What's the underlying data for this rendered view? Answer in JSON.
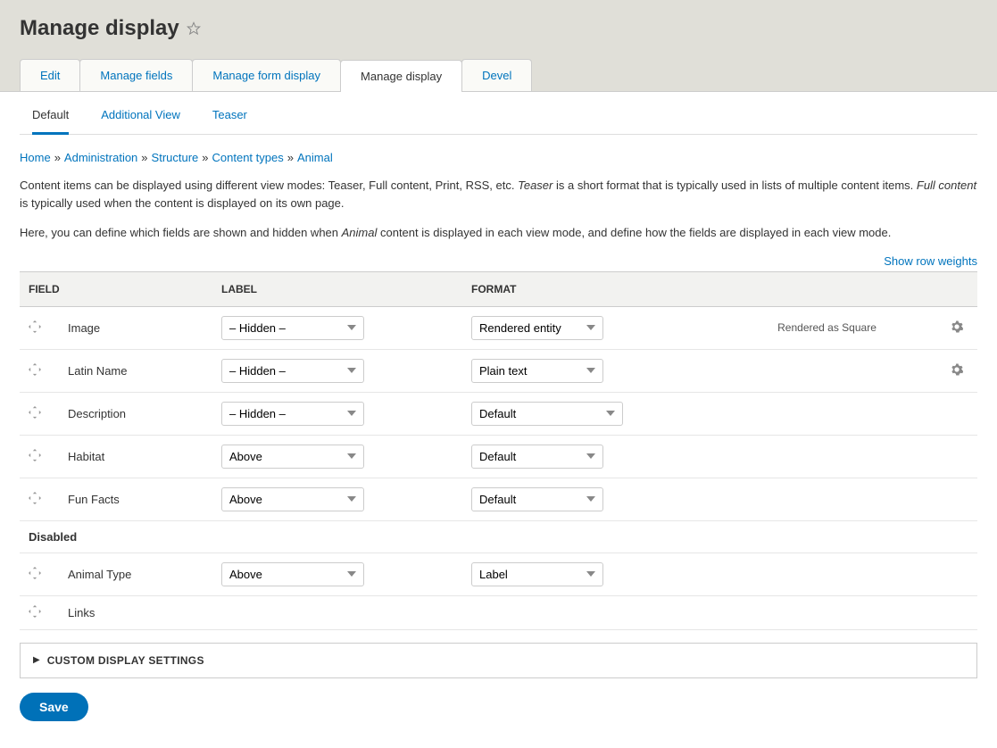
{
  "page_title": "Manage display",
  "primary_tabs": [
    {
      "label": "Edit",
      "active": false
    },
    {
      "label": "Manage fields",
      "active": false
    },
    {
      "label": "Manage form display",
      "active": false
    },
    {
      "label": "Manage display",
      "active": true
    },
    {
      "label": "Devel",
      "active": false
    }
  ],
  "secondary_tabs": [
    {
      "label": "Default",
      "active": true
    },
    {
      "label": "Additional View",
      "active": false
    },
    {
      "label": "Teaser",
      "active": false
    }
  ],
  "breadcrumb": [
    {
      "label": "Home"
    },
    {
      "label": "Administration"
    },
    {
      "label": "Structure"
    },
    {
      "label": "Content types"
    },
    {
      "label": "Animal"
    }
  ],
  "help_line1_a": "Content items can be displayed using different view modes: Teaser, Full content, Print, RSS, etc. ",
  "help_line1_em1": "Teaser",
  "help_line1_b": " is a short format that is typically used in lists of multiple content items. ",
  "help_line1_em2": "Full content",
  "help_line1_c": " is typically used when the content is displayed on its own page.",
  "help_line2_a": "Here, you can define which fields are shown and hidden when ",
  "help_line2_em": "Animal",
  "help_line2_b": " content is displayed in each view mode, and define how the fields are displayed in each view mode.",
  "toggle_weights": "Show row weights",
  "table": {
    "headers": {
      "field": "Field",
      "label": "Label",
      "format": "Format"
    },
    "rows": [
      {
        "field": "Image",
        "label_sel": "– Hidden –",
        "format_sel": "Rendered entity",
        "summary": "Rendered as Square",
        "gear": true
      },
      {
        "field": "Latin Name",
        "label_sel": "– Hidden –",
        "format_sel": "Plain text",
        "summary": "",
        "gear": true
      },
      {
        "field": "Description",
        "label_sel": "– Hidden –",
        "format_sel": "Default",
        "summary": "",
        "gear": false,
        "format_wide": true
      },
      {
        "field": "Habitat",
        "label_sel": "Above",
        "format_sel": "Default",
        "summary": "",
        "gear": false
      },
      {
        "field": "Fun Facts",
        "label_sel": "Above",
        "format_sel": "Default",
        "summary": "",
        "gear": false
      }
    ],
    "disabled_label": "Disabled",
    "disabled_rows": [
      {
        "field": "Animal Type",
        "label_sel": "Above",
        "format_sel": "Label",
        "summary": "",
        "gear": false
      },
      {
        "field": "Links",
        "no_selects": true
      }
    ]
  },
  "custom_display": "Custom display settings",
  "save_label": "Save"
}
